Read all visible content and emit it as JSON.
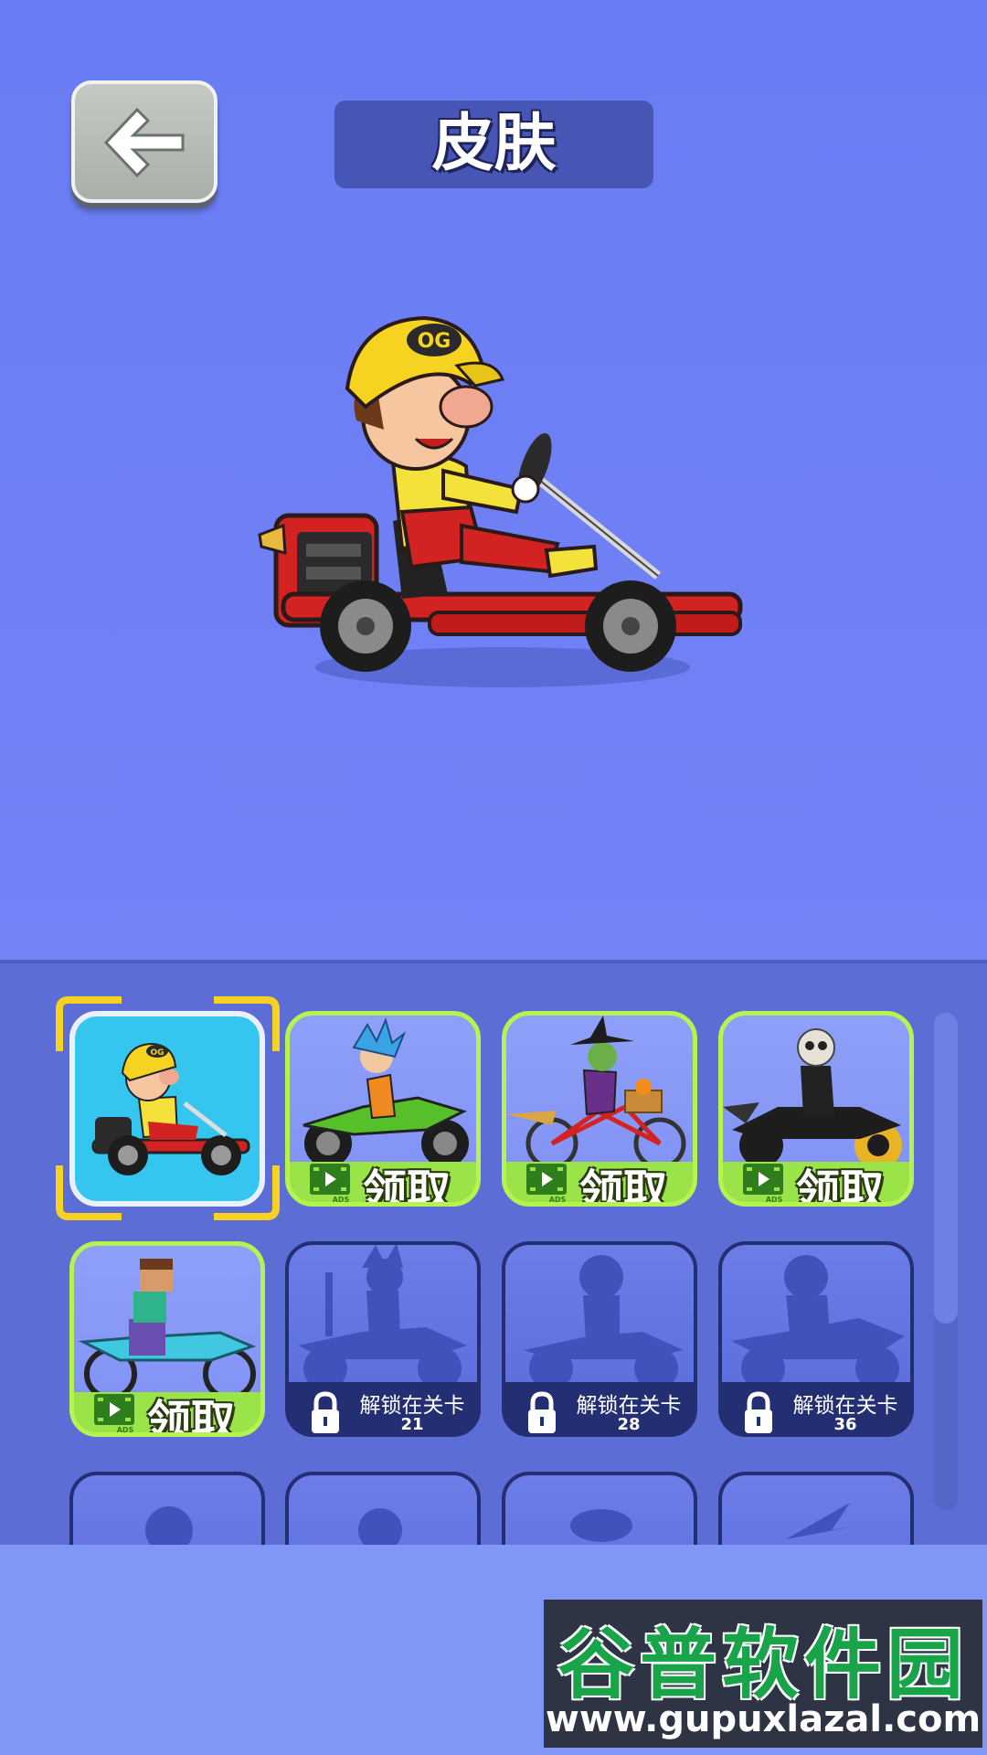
{
  "header": {
    "back_icon": "arrow-left-icon",
    "title": "皮肤"
  },
  "preview": {
    "character_cap_logo": "OG"
  },
  "skins": [
    {
      "state": "selected",
      "vehicle": "go-kart",
      "cap_logo": "OG"
    },
    {
      "state": "claim",
      "claim_label": "领取",
      "ad_badge": "ADS",
      "vehicle": "green-motorbike"
    },
    {
      "state": "claim",
      "claim_label": "领取",
      "ad_badge": "ADS",
      "vehicle": "witch-bicycle"
    },
    {
      "state": "claim",
      "claim_label": "领取",
      "ad_badge": "ADS",
      "vehicle": "skeleton-motorbike"
    },
    {
      "state": "claim",
      "claim_label": "领取",
      "ad_badge": "ADS",
      "vehicle": "block-dirtbike"
    },
    {
      "state": "locked",
      "unlock_label": "解锁在关卡",
      "level": "21"
    },
    {
      "state": "locked",
      "unlock_label": "解锁在关卡",
      "level": "28"
    },
    {
      "state": "locked",
      "unlock_label": "解锁在关卡",
      "level": "36"
    },
    {
      "state": "locked-partial"
    },
    {
      "state": "locked-partial"
    },
    {
      "state": "locked-partial"
    },
    {
      "state": "locked-partial"
    }
  ],
  "watermark": {
    "brand": "谷普软件园",
    "url": "www.gupuxlazal.com"
  },
  "colors": {
    "background": "#6d7ff6",
    "panel": "#5c6dd6",
    "claim_green": "#b6f34e",
    "locked_navy": "#242e73",
    "select_yellow": "#f5d320"
  }
}
